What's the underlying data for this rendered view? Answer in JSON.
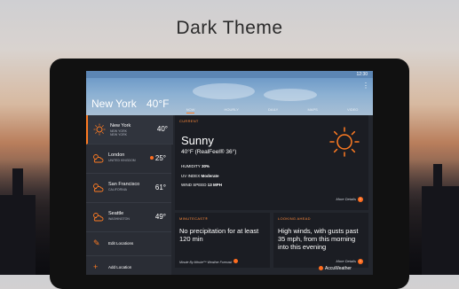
{
  "headline": "Dark Theme",
  "status": {
    "time": "12:30"
  },
  "hero": {
    "city": "New York",
    "temp": "40°F"
  },
  "tabs": [
    "NOW",
    "HOURLY",
    "DAILY",
    "MAPS",
    "VIDEO"
  ],
  "active_tab": "NOW",
  "locations": [
    {
      "name": "New York",
      "sub1": "NEW YORK",
      "sub2": "NEW YORK",
      "temp": "40°",
      "icon": "sun-icon",
      "selected": true,
      "alert": false
    },
    {
      "name": "London",
      "sub1": "UNITED KINGDOM",
      "temp": "25°",
      "icon": "partly-cloudy-icon",
      "selected": false,
      "alert": true
    },
    {
      "name": "San Francisco",
      "sub1": "CALIFORNIA",
      "temp": "61°",
      "icon": "partly-cloudy-icon",
      "selected": false,
      "alert": false
    },
    {
      "name": "Seattle",
      "sub1": "WASHINGTON",
      "temp": "49°",
      "icon": "partly-cloudy-icon",
      "selected": false,
      "alert": false
    }
  ],
  "actions": {
    "edit": "Edit Locations",
    "add": "Add Location"
  },
  "current": {
    "header": "CURRENT",
    "condition": "Sunny",
    "temp_line": "40°F (RealFeel® 36°)",
    "humidity_label": "HUMIDITY",
    "humidity_value": "30%",
    "uv_label": "UV INDEX",
    "uv_value": "Moderate",
    "wind_label": "WIND SPEED",
    "wind_value": "13 MPH",
    "more": "More Details"
  },
  "minutecast": {
    "header": "MINUTECAST®",
    "text": "No precipitation for at least 120 min",
    "footer": "Minute By Minute™ Weather Forecast"
  },
  "looking_ahead": {
    "header": "LOOKING AHEAD",
    "text": "High winds, with gusts past 35 mph, from this morning into this evening",
    "more": "More Details"
  },
  "brand": "AccuWeather",
  "colors": {
    "accent": "#ff7b22",
    "card": "#1b1d23",
    "sidebar": "#2a2d35",
    "sky": "#8db1d3"
  }
}
